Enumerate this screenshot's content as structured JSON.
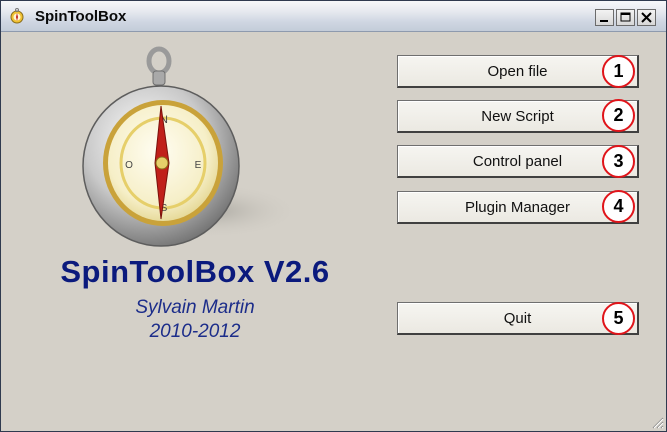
{
  "window": {
    "title": "SpinToolBox"
  },
  "app": {
    "name": "SpinToolBox V2.6",
    "author": "Sylvain Martin",
    "years": "2010-2012"
  },
  "buttons": [
    {
      "label": "Open file",
      "badge": "1"
    },
    {
      "label": "New Script",
      "badge": "2"
    },
    {
      "label": "Control panel",
      "badge": "3"
    },
    {
      "label": "Plugin Manager",
      "badge": "4"
    },
    {
      "label": "Quit",
      "badge": "5"
    }
  ],
  "colors": {
    "accent_text": "#0b1a7d",
    "badge_ring": "#e0141a",
    "window_bg": "#d4d0c8"
  }
}
